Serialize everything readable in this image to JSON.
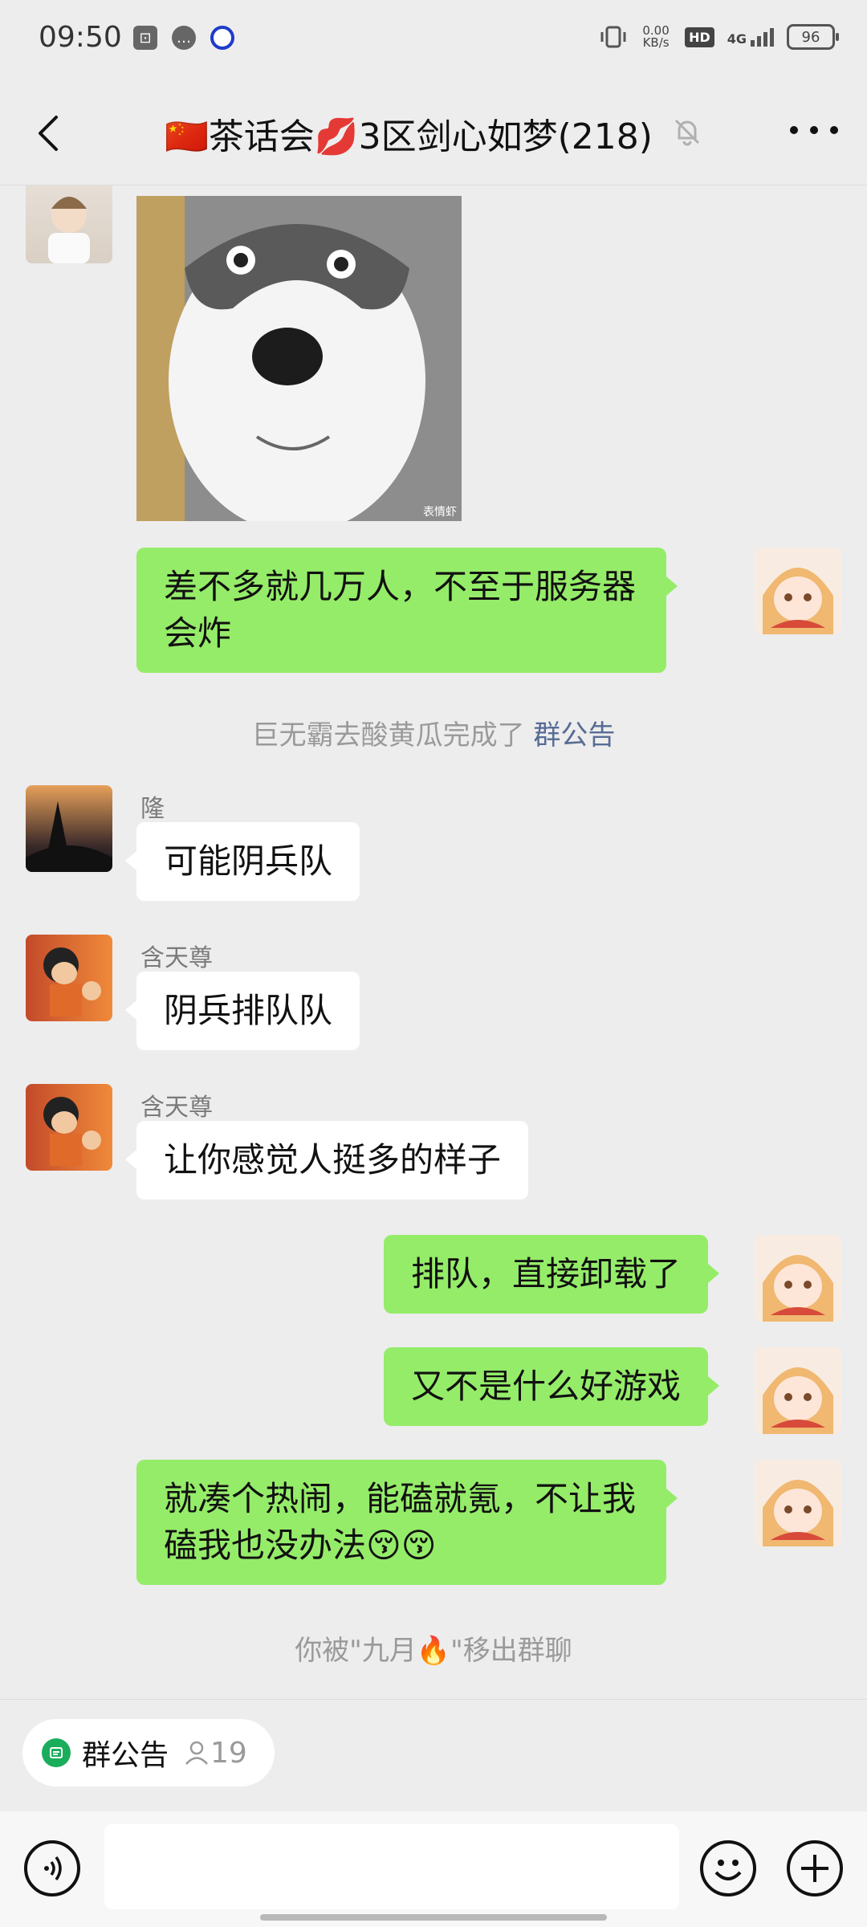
{
  "status_bar": {
    "time": "09:50",
    "net_speed_value": "0.00",
    "net_speed_unit": "KB/s",
    "hd": "HD",
    "network": "4G",
    "battery": "96"
  },
  "header": {
    "title": "🇨🇳茶话会💋3区剑心如梦(218)",
    "back_icon": "chevron-left-icon",
    "muted_icon": "bell-off-icon",
    "more_icon": "more-dots-icon"
  },
  "messages": {
    "m1_text": "差不多就几万人，不至于服务器会炸",
    "sys1_text": "巨无霸去酸黄瓜完成了 ",
    "sys1_link": "群公告",
    "m2_sender": "隆",
    "m2_text": "可能阴兵队",
    "m3_sender": "含天尊",
    "m3_text": "阴兵排队队",
    "m4_sender": "含天尊",
    "m4_text": "让你感觉人挺多的样子",
    "m5_text": "排队，直接卸载了",
    "m6_text": "又不是什么好游戏",
    "m7_text": "就凑个热闹，能磕就氪，不让我磕我也没办法😚😚",
    "sys2_text": "你被\"九月🔥\"移出群聊",
    "dog_watermark": "表情虾"
  },
  "bottom": {
    "notice_label": "群公告",
    "notice_count": "19"
  },
  "colors": {
    "my_bubble": "#95ec69",
    "other_bubble": "#ffffff",
    "link": "#576b95"
  }
}
